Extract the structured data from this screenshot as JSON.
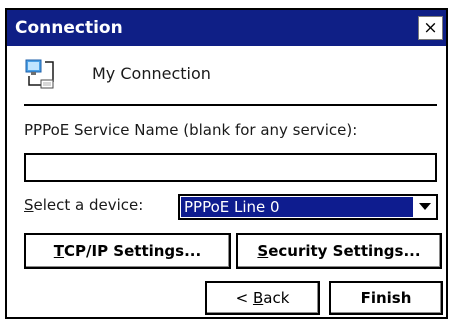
{
  "window": {
    "title": "Connection",
    "close_label": "×"
  },
  "connection": {
    "icon": "network-connection-icon",
    "name": "My Connection"
  },
  "service": {
    "label": "PPPoE Service Name (blank for any service):",
    "value": "",
    "placeholder": ""
  },
  "device": {
    "label_accel": "S",
    "label_rest": "elect a device:",
    "selected": "PPPoE Line 0",
    "arrow_icon": "chevron-down-icon"
  },
  "buttons": {
    "tcp_accel": "T",
    "tcp_rest": "CP/IP Settings...",
    "security_accel": "S",
    "security_rest": "ecurity Settings...",
    "back_prefix": "< ",
    "back_accel": "B",
    "back_rest": "ack",
    "finish": "Finish"
  },
  "colors": {
    "titlebar": "#0f1f86",
    "selection": "#0e1c8f"
  }
}
